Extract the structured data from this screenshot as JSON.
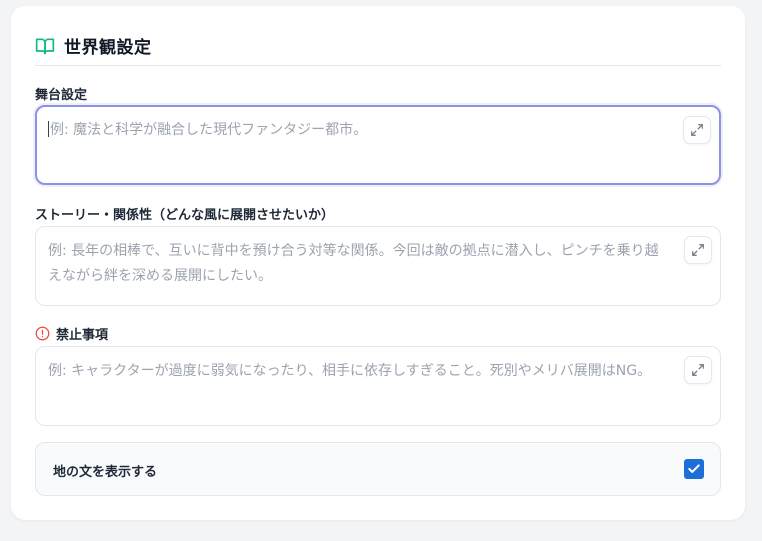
{
  "section": {
    "title": "世界観設定",
    "icon": "book-open-icon",
    "icon_color": "#10b981"
  },
  "fields": {
    "setting": {
      "label": "舞台設定",
      "placeholder": "例: 魔法と科学が融合した現代ファンタジー都市。",
      "focused": true
    },
    "story": {
      "label": "ストーリー・関係性（どんな風に展開させたいか）",
      "placeholder": "例: 長年の相棒で、互いに背中を預け合う対等な関係。今回は敵の拠点に潜入し、ピンチを乗り越えながら絆を深める展開にしたい。"
    },
    "prohibited": {
      "label": "禁止事項",
      "icon": "alert-circle-icon",
      "icon_color": "#ef4444",
      "placeholder": "例: キャラクターが過度に弱気になったり、相手に依存しすぎること。死別やメリバ展開はNG。"
    }
  },
  "toggle": {
    "label": "地の文を表示する",
    "checked": true,
    "accent": "#1d6fd8"
  },
  "focus_color": "#8b93e3"
}
